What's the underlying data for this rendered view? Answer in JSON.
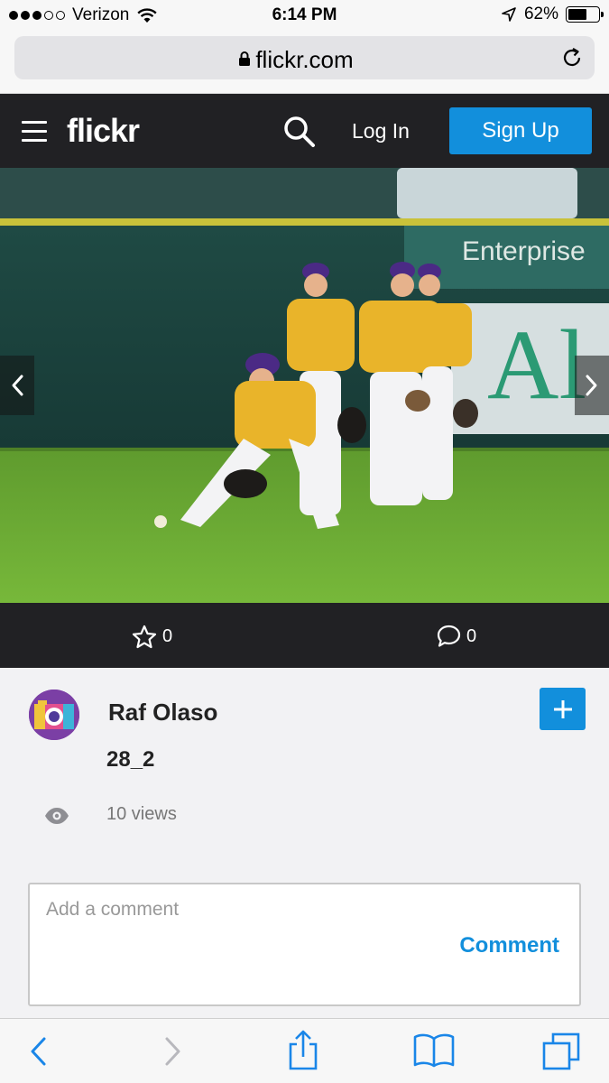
{
  "status_bar": {
    "carrier": "Verizon",
    "time": "6:14 PM",
    "battery": "62%",
    "battery_level": 0.62,
    "signal_bars": 3,
    "signal_total": 5
  },
  "browser": {
    "url": "flickr.com"
  },
  "nav": {
    "logo": "flickr",
    "login_label": "Log In",
    "signup_label": "Sign Up"
  },
  "photo_actions": {
    "favorites_count": "0",
    "comments_count": "0"
  },
  "photo_info": {
    "owner_name": "Raf Olaso",
    "title": "28_2",
    "views": "10 views"
  },
  "comment": {
    "placeholder": "Add a comment",
    "value": "",
    "button_label": "Comment"
  },
  "colors": {
    "accent": "#128fdc",
    "nav_bg": "#212124"
  },
  "icons": [
    "menu-icon",
    "search-icon",
    "star-icon",
    "comment-bubble-icon",
    "plus-icon",
    "eye-icon",
    "lock-icon",
    "reload-icon",
    "back-icon",
    "forward-icon",
    "share-icon",
    "bookmarks-icon",
    "tabs-icon"
  ]
}
